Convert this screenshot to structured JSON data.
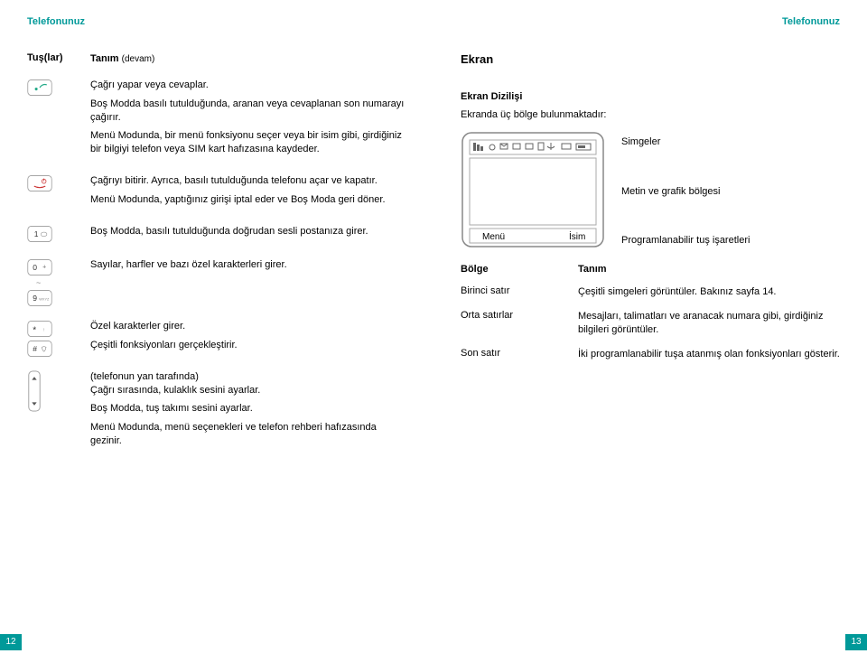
{
  "header": {
    "left": "Telefonunuz",
    "right": "Telefonunuz"
  },
  "left": {
    "col1_header": "Tuş(lar)",
    "col2_header": "Tanım",
    "cont": "(devam)",
    "rows": [
      {
        "icon": "call",
        "paras": [
          "Çağrı yapar veya cevaplar.",
          "Boş Modda basılı tutulduğunda, aranan veya cevaplanan son numarayı çağırır.",
          "Menü Modunda, bir menü fonksiyonu seçer veya bir isim gibi, girdiğiniz bir bilgiyi telefon veya SIM kart hafızasına kaydeder."
        ]
      },
      {
        "icon": "end",
        "paras": [
          "Çağrıyı bitirir. Ayrıca, basılı tutulduğunda telefonu açar ve kapatır.",
          "Menü Modunda, yaptığınız girişi iptal eder ve Boş Moda geri döner."
        ]
      },
      {
        "icon": "one",
        "paras": [
          "Boş Modda, basılı tutulduğunda doğrudan sesli postanıza girer."
        ]
      },
      {
        "icon": "zeronine",
        "paras": [
          "Sayılar, harfler ve bazı özel karakterleri girer."
        ]
      },
      {
        "icon": "starhash",
        "paras": [
          "Özel karakterler girer.",
          "Çeşitli fonksiyonları gerçekleştirir."
        ]
      },
      {
        "icon": "volume",
        "paras": [
          "(telefonun yan tarafında)\nÇağrı sırasında, kulaklık sesini ayarlar.",
          "Boş Modda, tuş takımı sesini ayarlar.",
          "Menü Modunda, menü seçenekleri ve telefon rehberi hafızasında gezinir."
        ]
      }
    ]
  },
  "right": {
    "title": "Ekran",
    "layout_title": "Ekran Dizilişi",
    "intro": "Ekranda üç bölge bulunmaktadır:",
    "labels": {
      "icons": "Simgeler",
      "text_area": "Metin ve grafik bölgesi",
      "softkeys": "Programlanabilir tuş işaretleri"
    },
    "screen_softkeys": {
      "menu": "Menü",
      "name": "İsim"
    },
    "table": {
      "h1": "Bölge",
      "h2": "Tanım",
      "rows": [
        {
          "area": "Birinci satır",
          "desc": "Çeşitli simgeleri görüntüler. Bakınız sayfa 14."
        },
        {
          "area": "Orta satırlar",
          "desc": "Mesajları, talimatları ve aranacak numara gibi, girdiğiniz bilgileri görüntüler."
        },
        {
          "area": "Son satır",
          "desc": "İki programlanabilir tuşa atanmış olan fonksiyonları gösterir."
        }
      ]
    }
  },
  "page_numbers": {
    "left": "12",
    "right": "13"
  }
}
